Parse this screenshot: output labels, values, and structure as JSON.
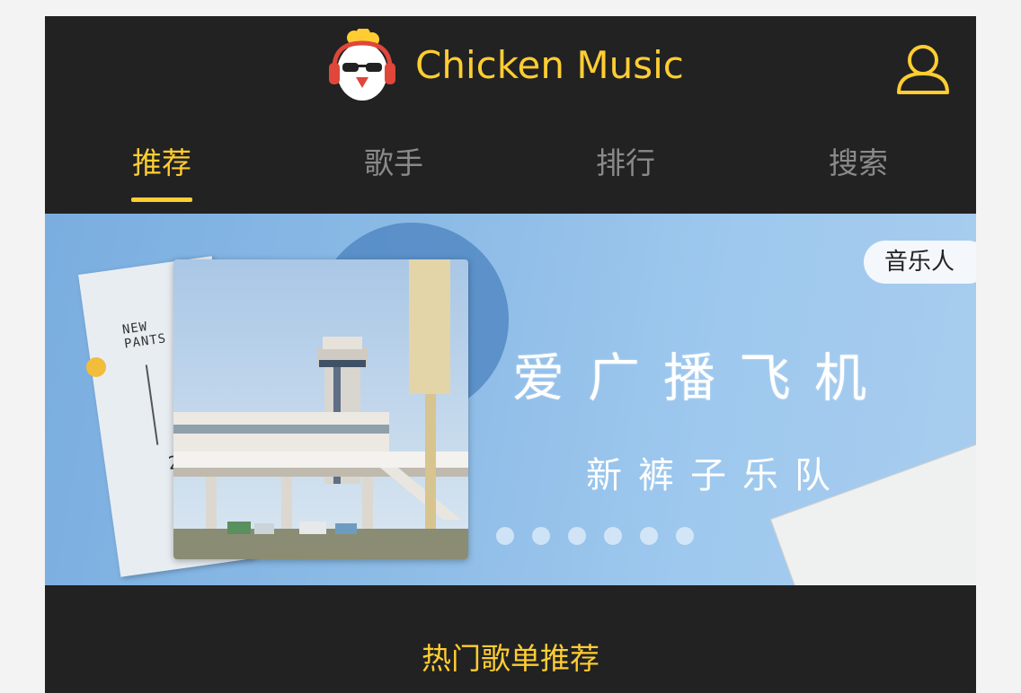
{
  "header": {
    "app_title": "Chicken Music",
    "logo_icon": "chicken-headphones-logo",
    "user_icon": "user-icon"
  },
  "tabs": [
    {
      "label": "推荐",
      "active": true
    },
    {
      "label": "歌手",
      "active": false
    },
    {
      "label": "排行",
      "active": false
    },
    {
      "label": "搜索",
      "active": false
    }
  ],
  "banner": {
    "tag": "音乐人",
    "title": "爱广播飞机",
    "subtitle": "新裤子乐队",
    "slide_count": 6,
    "accent_color": "#ffcd32"
  },
  "section": {
    "title": "热门歌单推荐"
  },
  "colors": {
    "background": "#222222",
    "accent": "#ffcd32",
    "inactive_tab": "#8a8a8a"
  }
}
